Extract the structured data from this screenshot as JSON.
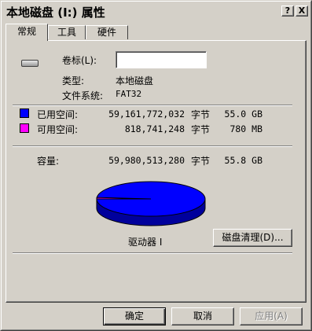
{
  "window": {
    "title": "本地磁盘 (I:) 属性",
    "help_button": "?",
    "close_button": "X"
  },
  "tabs": [
    {
      "label": "常规",
      "active": true
    },
    {
      "label": "工具",
      "active": false
    },
    {
      "label": "硬件",
      "active": false
    }
  ],
  "general": {
    "drive_icon": "hard-drive-icon",
    "volume_label": "卷标(L):",
    "volume_value": "",
    "type_label": "类型:",
    "type_value": "本地磁盘",
    "filesystem_label": "文件系统:",
    "filesystem_value": "FAT32",
    "used": {
      "label": "已用空间:",
      "bytes": "59,161,772,032",
      "unit": "字节",
      "human": "55.0 GB",
      "color": "#0000ff"
    },
    "free": {
      "label": "可用空间:",
      "bytes": "818,741,248",
      "unit": "字节",
      "human": "780 MB",
      "color": "#ff00ff"
    },
    "capacity": {
      "label": "容量:",
      "bytes": "59,980,513,280",
      "unit": "字节",
      "human": "55.8 GB"
    },
    "pie": {
      "used_fraction": 0.9863,
      "used_color": "#0000ff",
      "free_color": "#ff00ff"
    },
    "drive_label": "驱动器 I",
    "cleanup_button": "磁盘清理(D)..."
  },
  "buttons": {
    "ok": "确定",
    "cancel": "取消",
    "apply": "应用(A)"
  }
}
